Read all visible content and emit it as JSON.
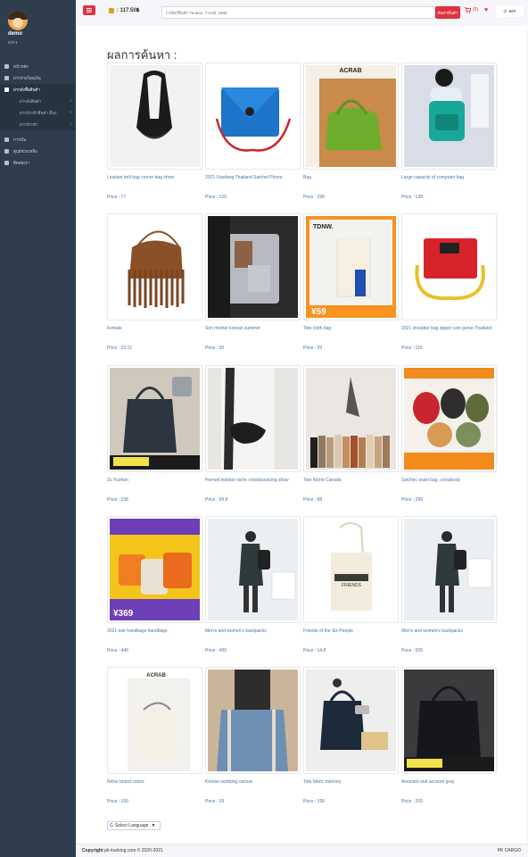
{
  "sidebar": {
    "user_name": "demo",
    "user_role": "ID9 ▾",
    "items": [
      {
        "label": "หน้าหลัก",
        "icon": "home-icon"
      },
      {
        "label": "ฝากจ่ายโอนเงิน",
        "icon": "money-icon"
      },
      {
        "label": "ฝากสั่งซื้อสินค้า",
        "icon": "bag-icon",
        "active": true
      },
      {
        "label": "ฝากสั่งสินค้า",
        "sub": true
      },
      {
        "label": "ฝากนำเข้าสินค้า อื่นๆ",
        "sub": true
      },
      {
        "label": "ฝากนำเข้า",
        "sub": true
      },
      {
        "label": "การเงิน",
        "icon": "wallet-icon"
      },
      {
        "label": "ศูนย์ช่วยเหลือ",
        "icon": "help-icon"
      },
      {
        "label": "ติดต่อเรา",
        "icon": "info-icon"
      }
    ]
  },
  "topbar": {
    "balance": ": 117.50฿",
    "search_placeholder": "วางลิงก์สินค้า Taobao, T-mall, 1688",
    "search_button": "ค้นหาสินค้า",
    "cart_count": "(5)",
    "logout_label": "ออก"
  },
  "main": {
    "title": "ผลการค้นหา :",
    "products": [
      {
        "title": "Lesbian belt bag corner bag show",
        "price": "Price : 77"
      },
      {
        "title": "2021 Xiaofang Thailand Satchel Phone",
        "price": "Price : 129"
      },
      {
        "title": "Bag",
        "price": "Price : 298"
      },
      {
        "title": "Large capacity of computer bag",
        "price": "Price : 138"
      },
      {
        "title": "Female",
        "price": "Price : 23.12"
      },
      {
        "title": "Son mother korean summer",
        "price": "Price : 30"
      },
      {
        "title": "Tote cloth bag",
        "price": "Price : 59"
      },
      {
        "title": "2021 shoulder bag zipper coin purse Thailand",
        "price": "Price : 119"
      },
      {
        "title": "Zu Yuzhan",
        "price": "Price : 338"
      },
      {
        "title": "Horned lesbian niche crowdsourcing show",
        "price": "Price : 69.8"
      },
      {
        "title": "Tote Niche Canada",
        "price": "Price : 88"
      },
      {
        "title": "Satchel, waist bag, crossbody",
        "price": "Price : 299"
      },
      {
        "title": "2021 tote handbags handbags",
        "price": "Price : 449"
      },
      {
        "title": "Men's and women's backpacks",
        "price": "Price : 499"
      },
      {
        "title": "Friends of the Six People",
        "price": "Price : 14.8"
      },
      {
        "title": "Men's and women's backpacks",
        "price": "Price : 559"
      },
      {
        "title": "Niche brand colors",
        "price": "Price : 159"
      },
      {
        "title": "Korean webbing canvas",
        "price": "Price : 39"
      },
      {
        "title": "Tote fabric memory",
        "price": "Price : 199"
      },
      {
        "title": "Ancestor and account gray",
        "price": "Price : 209"
      }
    ],
    "language_select": "Select Language"
  },
  "footer": {
    "copyright_bold": "Copyright",
    "copyright_rest": " pk-tracking.com © 2020-2021",
    "brand": "PK CARGO"
  }
}
